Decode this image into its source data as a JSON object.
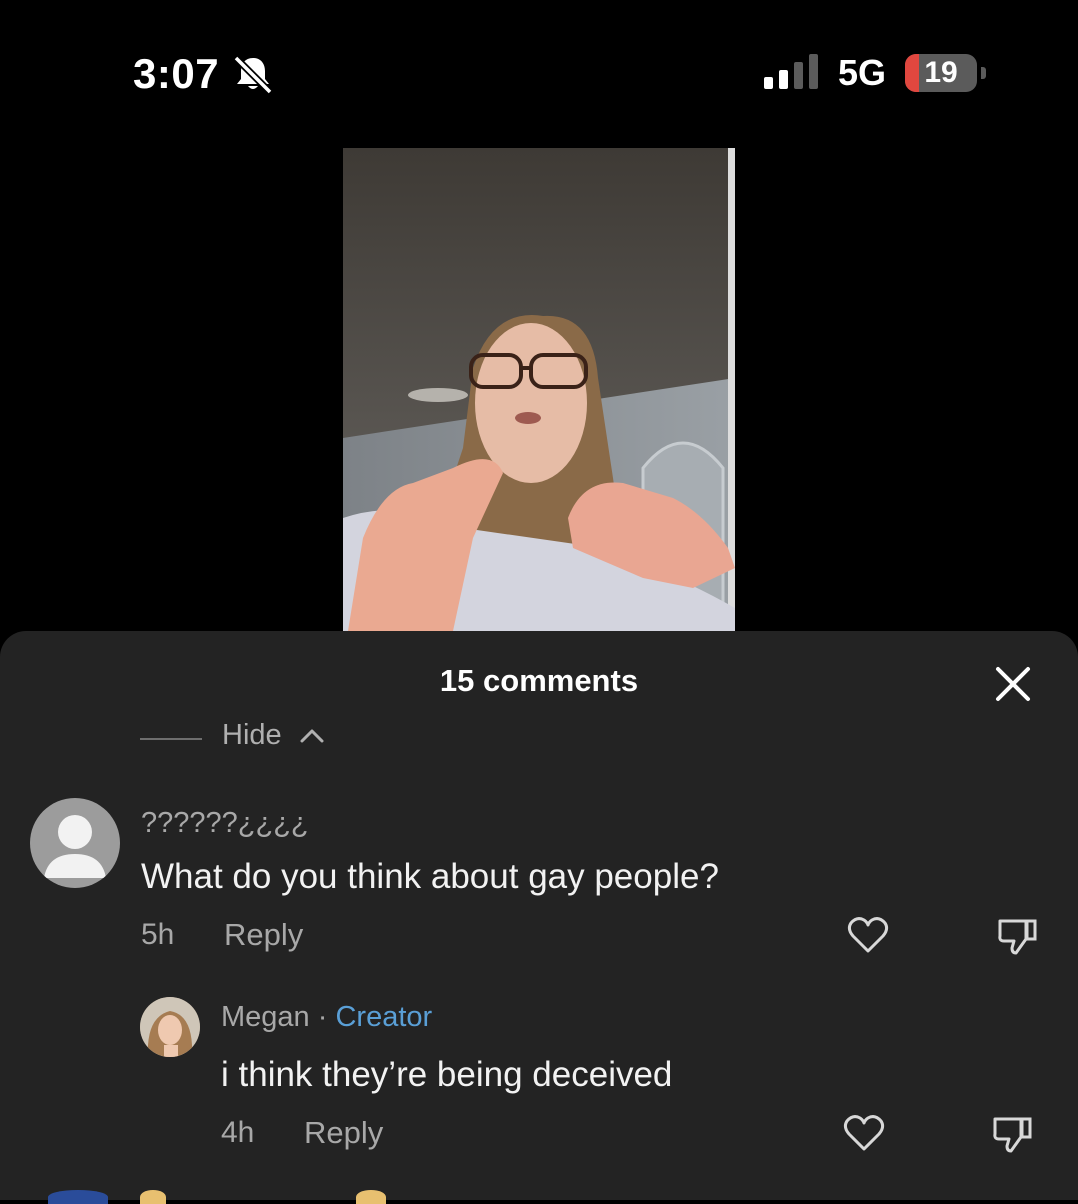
{
  "status_bar": {
    "time": "3:07",
    "network": "5G",
    "battery_level": "19",
    "battery_fraction": 0.19,
    "signal_bars_active": 2,
    "icons": [
      "bell-slash-icon",
      "signal-icon",
      "battery-icon"
    ]
  },
  "comments_sheet": {
    "title": "15 comments",
    "hide_label": "Hide",
    "comments": [
      {
        "username": "??????¿¿¿¿",
        "text": "What do you think about gay people?",
        "time": "5h",
        "reply_label": "Reply"
      },
      {
        "username": "Megan",
        "separator": "·",
        "badge": "Creator",
        "text": "i think they’re being deceived",
        "time": "4h",
        "reply_label": "Reply"
      }
    ]
  },
  "colors": {
    "sheet_background": "#232323",
    "creator_badge": "#5a9fd6",
    "battery_low": "#e0473f",
    "secondary_text": "#a8a8a8"
  }
}
